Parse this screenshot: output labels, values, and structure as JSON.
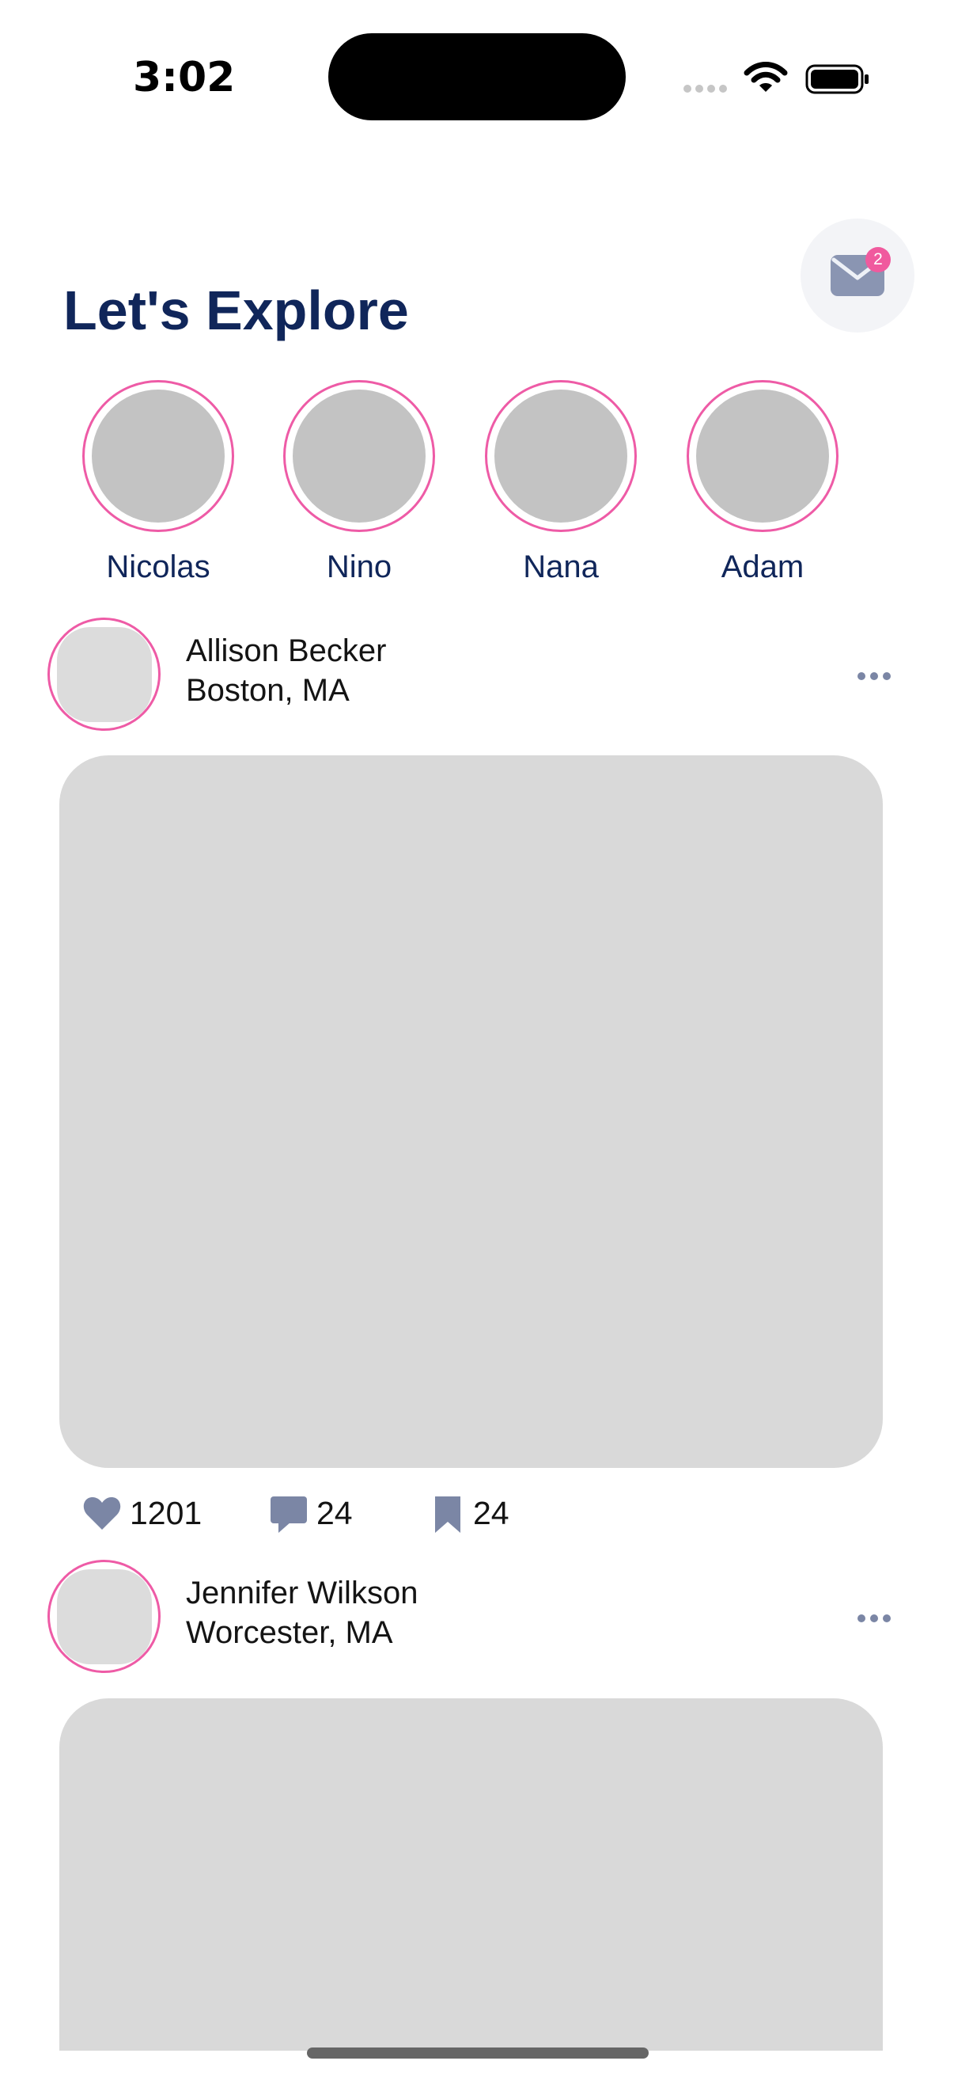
{
  "status_bar": {
    "time": "3:02"
  },
  "header": {
    "title": "Let's Explore",
    "messages_badge": "2"
  },
  "stories": [
    {
      "name": "Nicolas"
    },
    {
      "name": "Nino"
    },
    {
      "name": "Nana"
    },
    {
      "name": "Adam"
    }
  ],
  "posts": [
    {
      "author": "Allison Becker",
      "location": "Boston, MA",
      "likes": "1201",
      "comments": "24",
      "saves": "24"
    },
    {
      "author": "Jennifer Wilkson",
      "location": "Worcester, MA"
    }
  ],
  "colors": {
    "accent_pink": "#ee5ba6",
    "title_navy": "#10265a",
    "icon_gray_blue": "#7b86a5",
    "placeholder_gray": "#d9d9d9"
  },
  "icons": {
    "messages": "envelope-icon",
    "more": "ellipsis-icon",
    "like": "heart-icon",
    "comment": "comment-icon",
    "save": "bookmark-icon"
  }
}
